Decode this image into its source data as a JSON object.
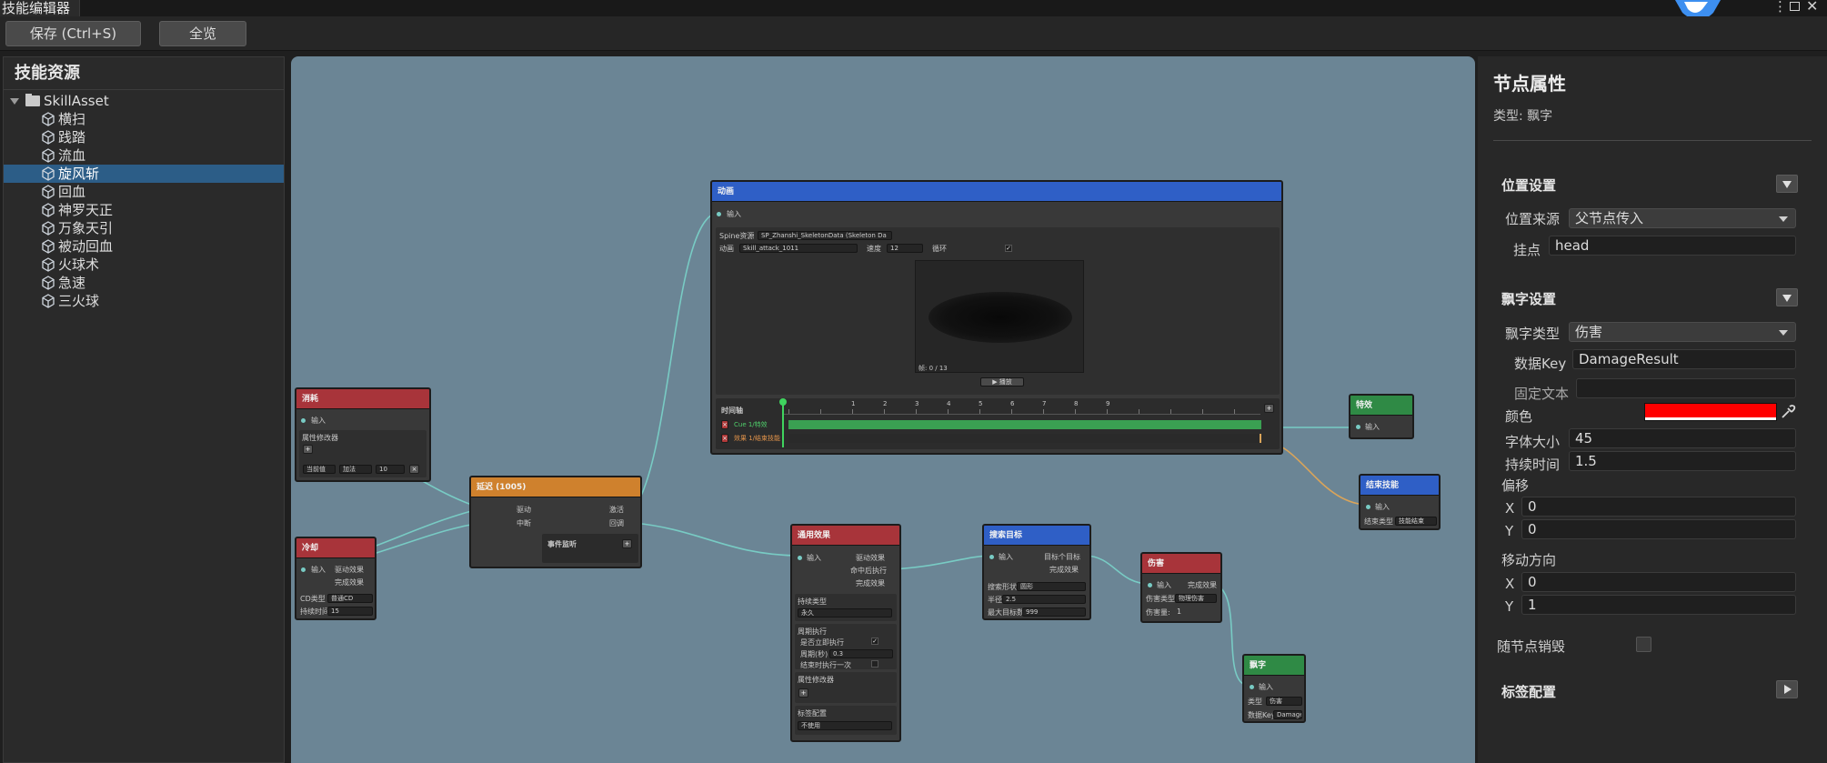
{
  "window": {
    "title": "技能编辑器"
  },
  "toolbar": {
    "save_label": "保存 (Ctrl+S)",
    "fit_label": "全览"
  },
  "left_panel": {
    "title": "技能资源",
    "root": "SkillAsset",
    "items": [
      {
        "label": "横扫",
        "selected": false
      },
      {
        "label": "践踏",
        "selected": false
      },
      {
        "label": "流血",
        "selected": false
      },
      {
        "label": "旋风斩",
        "selected": true
      },
      {
        "label": "回血",
        "selected": false
      },
      {
        "label": "神罗天正",
        "selected": false
      },
      {
        "label": "万象天引",
        "selected": false
      },
      {
        "label": "被动回血",
        "selected": false
      },
      {
        "label": "火球术",
        "selected": false
      },
      {
        "label": "急速",
        "selected": false
      },
      {
        "label": "三火球",
        "selected": false
      }
    ]
  },
  "graph": {
    "consume": {
      "title": "消耗",
      "in": "输入",
      "attr_mod": "属性修改器",
      "add": "+",
      "dd1": "当前值",
      "dd2": "加法",
      "value": "10",
      "del": "×"
    },
    "cooldown": {
      "title": "冷却",
      "in": "输入",
      "out1": "驱动效果",
      "out2": "完成效果",
      "cd_type_label": "CD类型",
      "cd_type": "普通CD",
      "duration_label": "持续时间",
      "duration": "15"
    },
    "delay": {
      "title": "延迟 (1005)",
      "in1": "驱动",
      "in2": "中断",
      "out1": "激活",
      "out2": "回调",
      "event_label": "事件监听",
      "add": "+"
    },
    "animation": {
      "title": "动画",
      "in": "输入",
      "spine_label": "Spine资源",
      "spine_value": "SP_Zhanshi_SkeletonData (Skeleton Da",
      "anim_label": "动画",
      "anim_value": "Skill_attack_1011",
      "speed_label": "速度",
      "speed_value": "12",
      "loop_label": "循环",
      "loop_check": "✓",
      "frame_text": "帧: 0 / 13",
      "play_label": "▶ 播放",
      "timeline_label": "时间轴",
      "ticks": [
        "1",
        "2",
        "3",
        "4",
        "5",
        "6",
        "7",
        "8",
        "9"
      ],
      "track1": "Cue 1/特效",
      "track2": "效果 1/结束技能",
      "add": "+",
      "del": "×"
    },
    "effect_fx": {
      "title": "特效",
      "in": "输入"
    },
    "end_skill": {
      "title": "结束技能",
      "in": "输入",
      "end_type_label": "结束类型",
      "end_type": "技能结束"
    },
    "general": {
      "title": "通用效果",
      "in": "输入",
      "out1": "驱动效果",
      "out2": "命中后执行",
      "out3": "完成效果",
      "duration_type_label": "持续类型",
      "duration_type": "永久",
      "period_label": "周期执行",
      "immediate_label": "是否立即执行",
      "immediate_check": "✓",
      "interval_label": "周期(秒)",
      "interval": "0.3",
      "exit_label": "结束时执行一次",
      "attr_label": "属性修改器",
      "add": "+",
      "tag_label": "标签配置",
      "tag_value": "不使用"
    },
    "target": {
      "title": "搜索目标",
      "in": "输入",
      "out1": "目标个目标",
      "out2": "完成效果",
      "shape_label": "搜索形状",
      "shape": "圆形",
      "radius_label": "半径",
      "radius": "2.5",
      "max_label": "最大目标数",
      "max": "999"
    },
    "damage": {
      "title": "伤害",
      "in": "输入",
      "out": "完成效果",
      "type_label": "伤害类型",
      "type": "物理伤害",
      "factor_label": "伤害量:",
      "factor": "1"
    },
    "float": {
      "title": "飘字",
      "in": "输入",
      "type_label": "类型",
      "type": "伤害",
      "key_label": "数据Key",
      "key": "Damage"
    }
  },
  "props": {
    "title": "节点属性",
    "type_text": "类型: 飘字",
    "pos_section": "位置设置",
    "pos_source_label": "位置来源",
    "pos_source": "父节点传入",
    "mount_label": "挂点",
    "mount": "head",
    "float_section": "飘字设置",
    "float_type_label": "飘字类型",
    "float_type": "伤害",
    "data_key_label": "数据Key",
    "data_key": "DamageResult",
    "fixed_text_label": "固定文本",
    "fixed_text": "",
    "color_label": "颜色",
    "color": "#ff0000",
    "font_size_label": "字体大小",
    "font_size": "45",
    "duration_label": "持续时间",
    "duration": "1.5",
    "offset_label": "偏移",
    "offset_x_label": "X",
    "offset_x": "0",
    "offset_y_label": "Y",
    "offset_y": "0",
    "move_label": "移动方向",
    "move_x_label": "X",
    "move_x": "0",
    "move_y_label": "Y",
    "move_y": "1",
    "follow_label": "随节点销毁",
    "follow_checked": false,
    "tag_section": "标签配置"
  },
  "colors": {
    "accent": "#2c5d87",
    "node_red": "#a8343a",
    "node_orange": "#cf812d",
    "node_blue": "#2f5fc6",
    "node_green": "#2f8a45",
    "wire": "#78cbc4",
    "wire_orange": "#d9a45a",
    "canvas": "#6b8595"
  },
  "icons": [
    "skill-asset-icon",
    "folder-icon",
    "eyedropper-icon",
    "fold-arrow-icon",
    "menu-dots-icon",
    "maximize-icon",
    "close-icon",
    "logo-icon"
  ]
}
